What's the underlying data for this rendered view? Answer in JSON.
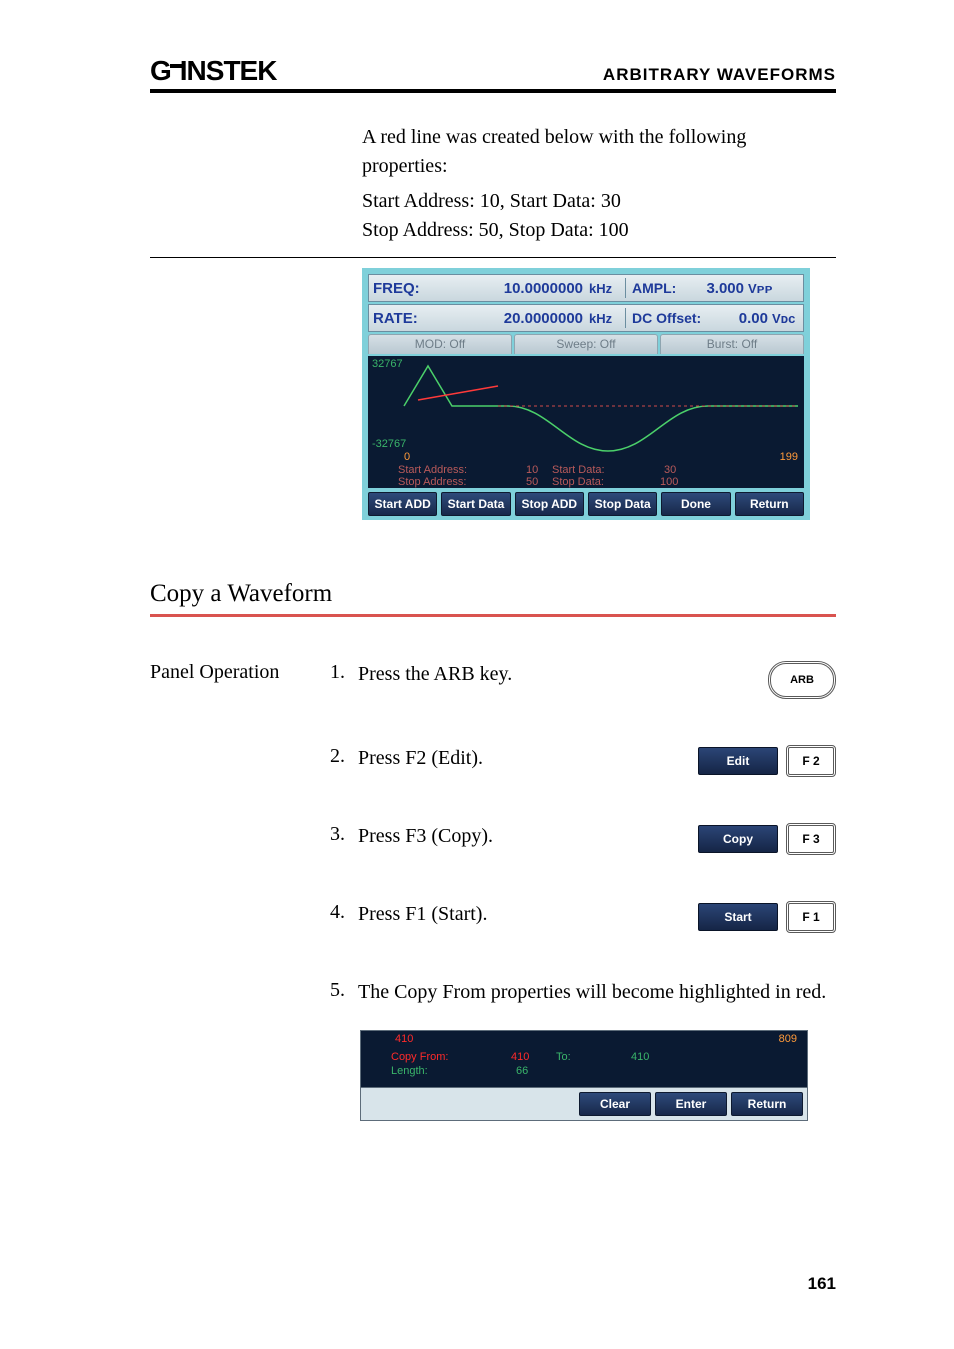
{
  "header": {
    "logo_prefix": "G",
    "logo_rest": "INSTEK",
    "doc_title": "ARBITRARY WAVEFORMS"
  },
  "intro": {
    "line1": "A red line was created below with the following properties:",
    "line2": "Start Address: 10, Start Data: 30",
    "line3": "Stop Address: 50, Stop Data: 100"
  },
  "screen1": {
    "row1": {
      "label": "FREQ:",
      "value": "10.0000000",
      "unit": "kHz",
      "label2": "AMPL:",
      "value2": "3.000",
      "unit2": "Vᴘᴘ"
    },
    "row2": {
      "label": "RATE:",
      "value": "20.0000000",
      "unit": "kHz",
      "label2": "DC Offset:",
      "value2": "0.00",
      "unit2": "Vᴅᴄ"
    },
    "tabs": [
      "MOD: Off",
      "Sweep: Off",
      "Burst: Off"
    ],
    "y_top": "32767",
    "y_bot": "-32767",
    "x_left": "0",
    "x_right": "199",
    "addr": {
      "l1a": "Start Address:",
      "l1b": "10",
      "l1c": "Start Data:",
      "l1d": "30",
      "l2a": "Stop Address:",
      "l2b": "50",
      "l2c": "Stop Data:",
      "l2d": "100"
    },
    "softkeys": [
      "Start ADD",
      "Start Data",
      "Stop ADD",
      "Stop Data",
      "Done",
      "Return"
    ]
  },
  "section_title": "Copy a Waveform",
  "panel_operation_label": "Panel Operation",
  "steps": {
    "s1": {
      "num": "1.",
      "text": "Press the ARB key.",
      "btn": "ARB"
    },
    "s2": {
      "num": "2.",
      "text": "Press F2 (Edit).",
      "blue": "Edit",
      "f": "F 2"
    },
    "s3": {
      "num": "3.",
      "text": "Press F3 (Copy).",
      "blue": "Copy",
      "f": "F 3"
    },
    "s4": {
      "num": "4.",
      "text": "Press F1 (Start).",
      "blue": "Start",
      "f": "F 1"
    },
    "s5": {
      "num": "5.",
      "text": "The Copy From properties will become highlighted in red."
    }
  },
  "screen2": {
    "top_left": "410",
    "top_right": "809",
    "copy_from_label": "Copy From:",
    "copy_from_val": "410",
    "to_label": "To:",
    "to_val": "410",
    "length_label": "Length:",
    "length_val": "66",
    "softkeys": [
      "Clear",
      "Enter",
      "Return"
    ]
  },
  "page_number": "161"
}
